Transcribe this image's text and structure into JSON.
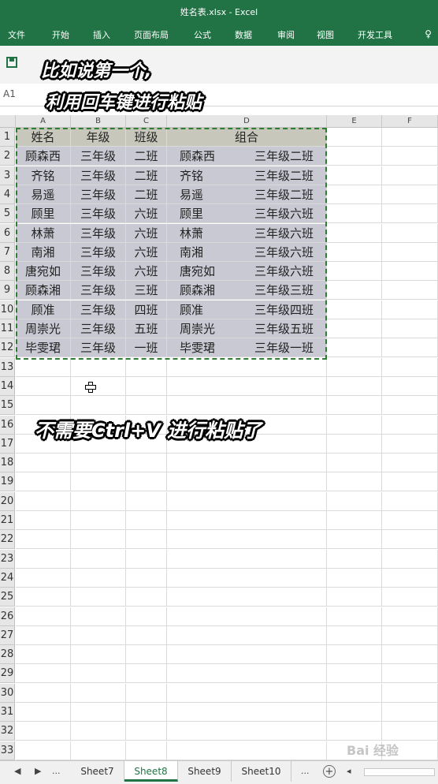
{
  "window": {
    "title": "姓名表.xlsx - Excel"
  },
  "ribbon": {
    "tabs": [
      "文件",
      "开始",
      "插入",
      "页面布局",
      "公式",
      "数据",
      "审阅",
      "视图",
      "开发工具"
    ],
    "help_icon": "lightbulb-icon"
  },
  "namebox": {
    "value": "A1"
  },
  "captions": {
    "line1": "比如说第一个,",
    "line2": "利用回车键进行粘贴",
    "line3": "不需要Ctrl+V 进行粘贴了"
  },
  "columns": [
    "A",
    "B",
    "C",
    "D",
    "E",
    "F"
  ],
  "table": {
    "headers": [
      "姓名",
      "年级",
      "班级",
      "组合"
    ],
    "rows": [
      [
        "顾森西",
        "三年级",
        "二班",
        "顾森西",
        "三年级二班"
      ],
      [
        "齐铭",
        "三年级",
        "二班",
        "齐铭",
        "三年级二班"
      ],
      [
        "易遥",
        "三年级",
        "二班",
        "易遥",
        "三年级二班"
      ],
      [
        "顾里",
        "三年级",
        "六班",
        "顾里",
        "三年级六班"
      ],
      [
        "林萧",
        "三年级",
        "六班",
        "林萧",
        "三年级六班"
      ],
      [
        "南湘",
        "三年级",
        "六班",
        "南湘",
        "三年级六班"
      ],
      [
        "唐宛如",
        "三年级",
        "六班",
        "唐宛如",
        "三年级六班"
      ],
      [
        "顾森湘",
        "三年级",
        "三班",
        "顾森湘",
        "三年级三班"
      ],
      [
        "顾准",
        "三年级",
        "四班",
        "顾准",
        "三年级四班"
      ],
      [
        "周崇光",
        "三年级",
        "五班",
        "周崇光",
        "三年级五班"
      ],
      [
        "毕雯珺",
        "三年级",
        "一班",
        "毕雯珺",
        "三年级一班"
      ]
    ]
  },
  "row_numbers": [
    "1",
    "2",
    "3",
    "4",
    "5",
    "6",
    "7",
    "8",
    "9",
    "10",
    "11",
    "12",
    "13",
    "14",
    "15",
    "16",
    "17",
    "18",
    "19",
    "20",
    "21",
    "22",
    "23",
    "24",
    "25",
    "26",
    "27",
    "28",
    "29",
    "30",
    "31",
    "32",
    "33"
  ],
  "sheet_tabs": {
    "nav": [
      "◀",
      "▶",
      "..."
    ],
    "tabs": [
      "Sheet7",
      "Sheet8",
      "Sheet9",
      "Sheet10"
    ],
    "active": "Sheet8",
    "more": "...",
    "add": "+"
  },
  "watermark": "Bai 经验",
  "colors": {
    "excel_green": "#217346",
    "selection_fill": "#c9c9d3",
    "header_fill": "#c7c7bb"
  }
}
